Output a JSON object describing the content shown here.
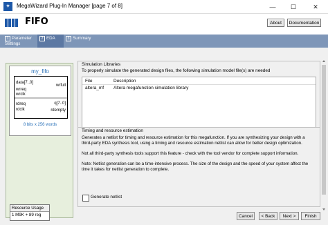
{
  "window": {
    "title": "MegaWizard Plug-In Manager [page 7 of 8]",
    "minimize": "—",
    "maximize": "☐",
    "close": "✕"
  },
  "header": {
    "title": "FIFO",
    "about_label": "About",
    "documentation_label": "Documentation"
  },
  "steps": [
    {
      "num": "1",
      "label": "Parameter Settings"
    },
    {
      "num": "2",
      "label": "EDA"
    },
    {
      "num": "3",
      "label": "Summary"
    }
  ],
  "symbol": {
    "title": "my_fifo",
    "pins_left": [
      "data[7..0]",
      "wrreq",
      "wrclk",
      "rdreq",
      "rdclk"
    ],
    "pins_right": [
      "wrfull",
      "q[7..0]",
      "rdempty"
    ],
    "footer": "8 bits x 256 words"
  },
  "resource": {
    "label": "Resource Usage",
    "value": "1 M9K + 89 reg"
  },
  "simulation": {
    "group_title": "Simulation Libraries",
    "description": "To properly simulate the generated design files, the following simulation model file(s) are needed",
    "columns": [
      "File",
      "Description"
    ],
    "rows": [
      {
        "file": "altera_mf",
        "description": "Altera megafunction simulation library"
      }
    ]
  },
  "timing": {
    "group_title": "Timing and resource estimation",
    "para1": "Generates a netlist for timing and resource estimation for this megafunction. If you are synthesizing your design with a third-party EDA synthesis tool, using a timing and resource estimation netlist can allow for better design optimization.",
    "para2": "Not all third-party synthesis tools support this feature - check with the tool vendor for complete support information.",
    "para3": "Note: Netlist generation can be a time-intensive process. The size of the design and the speed of your system affect the time it takes for netlist generation to complete.",
    "checkbox_label": "Generate netlist",
    "checkbox_checked": false
  },
  "footer": {
    "cancel": "Cancel",
    "back": "< Back",
    "next": "Next >",
    "finish": "Finish"
  }
}
